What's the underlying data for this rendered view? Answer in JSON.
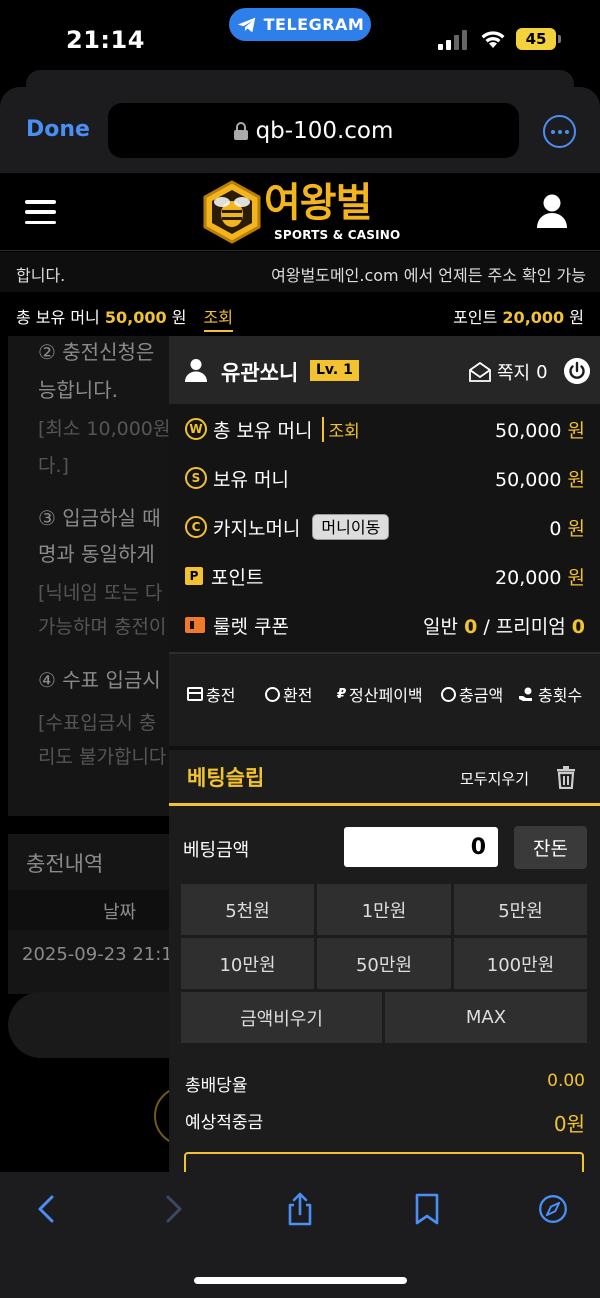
{
  "status_bar": {
    "time": "21:14",
    "banner": "TELEGRAM",
    "battery": "45",
    "banner_color": "#2f7fea",
    "battery_color": "#f4d23b"
  },
  "browser": {
    "done_label": "Done",
    "url": "qb-100.com",
    "accent_color": "#4a8ff5"
  },
  "site": {
    "logo_title": "여왕벌",
    "logo_subtitle": "SPORTS & CASINO",
    "brand_color": "#f2b51d"
  },
  "ticker": {
    "left_text": "합니다.",
    "right_text": "여왕벌도메인.com 에서 언제든 주소 확인 가능"
  },
  "balance_bar": {
    "money_label": "총 보유 머니",
    "money_value": "50,000",
    "money_unit": "원",
    "lookup_label": "조회",
    "point_label": "포인트",
    "point_value": "20,000",
    "point_unit": "원"
  },
  "background_page": {
    "notice_lines": [
      "② 충전신청은",
      "능합니다.",
      "[최소 10,000원",
      "다.]",
      "③ 입금하실 때",
      "명과 동일하게",
      "[닉네임 또는 다",
      "가능하며 충전이",
      "④ 수표 입금시",
      "[수표입금시 충",
      "리도 불가합니다"
    ],
    "history_title": "충전내역",
    "history_col_date": "날짜",
    "history_row_date": "2025-09-23 21:1"
  },
  "panel": {
    "user": {
      "name": "유관쏘니",
      "level": "Lv. 1",
      "message_label": "쪽지",
      "message_count": "0"
    },
    "rows": {
      "total_money_label": "총 보유 머니",
      "total_money_lookup": "조회",
      "total_money_value": "50,000",
      "held_money_label": "보유 머니",
      "held_money_value": "50,000",
      "casino_money_label": "카지노머니",
      "casino_move_label": "머니이동",
      "casino_money_value": "0",
      "point_label": "포인트",
      "point_value": "20,000",
      "coupon_label": "룰렛 쿠폰",
      "coupon_normal_label": "일반",
      "coupon_normal_value": "0",
      "coupon_premium_label": "프리미엄",
      "coupon_premium_value": "0",
      "unit": "원",
      "coin_w": "W",
      "coin_s": "S",
      "coin_c": "C",
      "badge_p": "P",
      "separator": "/"
    },
    "actions": [
      "충전",
      "환전",
      "정산페이백",
      "충금액",
      "충횟수"
    ],
    "action_icons": [
      "card-icon",
      "coin-exchange-icon",
      "payback-icon",
      "deposit-amount-icon",
      "deposit-count-icon"
    ],
    "slip": {
      "title": "베팅슬립",
      "clear_label": "모두지우기"
    },
    "bet": {
      "amount_label": "베팅금액",
      "amount_value": "0",
      "change_label": "잔돈",
      "quick_amounts": [
        "5천원",
        "1만원",
        "5만원",
        "10만원",
        "50만원",
        "100만원"
      ],
      "clear_amount_label": "금액비우기",
      "max_label": "MAX",
      "total_odds_label": "총배당율",
      "total_odds_value": "0.00",
      "expected_win_label": "예상적중금",
      "expected_win_value": "0원"
    }
  }
}
